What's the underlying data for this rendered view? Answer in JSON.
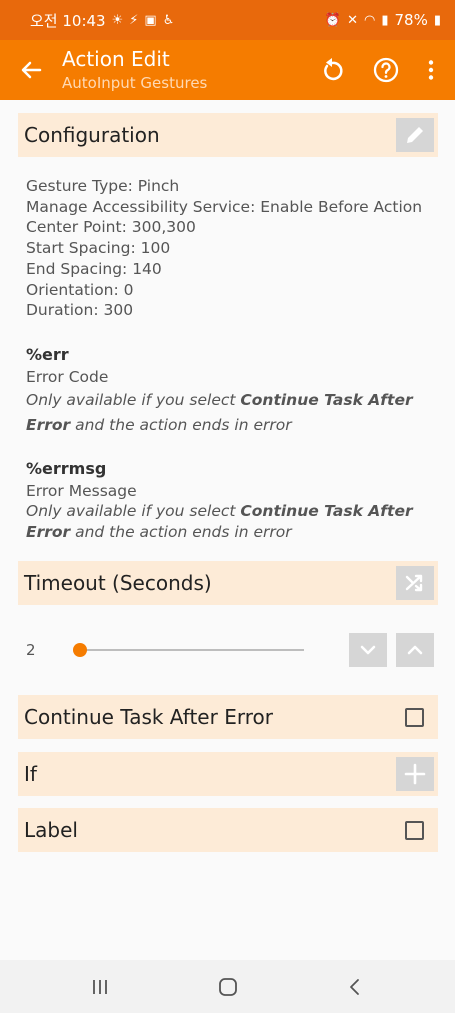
{
  "status_bar": {
    "time": "오전 10:43",
    "battery": "78%"
  },
  "app_bar": {
    "title": "Action Edit",
    "subtitle": "AutoInput Gestures"
  },
  "configuration": {
    "header": "Configuration",
    "lines": [
      "Gesture Type: Pinch",
      "Manage Accessibility Service: Enable Before Action",
      "Center Point: 300,300",
      "Start Spacing: 100",
      "End Spacing: 140",
      "Orientation: 0",
      "Duration: 300"
    ]
  },
  "variables": [
    {
      "name": "%err",
      "label": "Error Code",
      "note_prefix": "Only available if you select ",
      "note_bold_1": "Continue Task After",
      "note_bold_2": "Error",
      "note_suffix": " and the action ends in error"
    },
    {
      "name": "%errmsg",
      "label": "Error Message",
      "note_prefix": "Only available if you select ",
      "note_bold_1": "Continue Task After",
      "note_bold_2": "Error",
      "note_suffix": " and the action ends in error"
    }
  ],
  "timeout": {
    "header": "Timeout (Seconds)",
    "value": "2",
    "slider_fraction": 0.0
  },
  "options": {
    "continue_task": "Continue Task After Error",
    "if_label": "If",
    "label_label": "Label"
  },
  "colors": {
    "accent": "#f57c00",
    "status_bar": "#e8690c",
    "section_bg": "#fdebd7"
  }
}
